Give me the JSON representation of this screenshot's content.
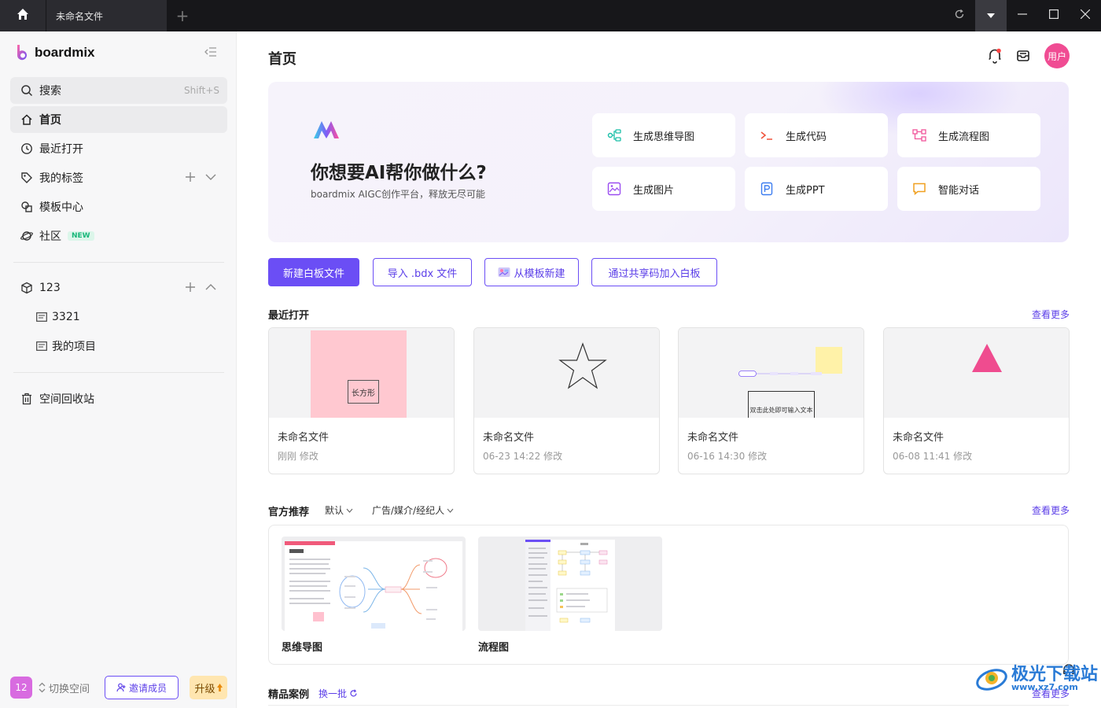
{
  "titlebar": {
    "tab_title": "未命名文件",
    "new_tab": "+"
  },
  "sidebar": {
    "brand": "boardmix",
    "search": {
      "label": "搜索",
      "shortcut": "Shift+S"
    },
    "items": [
      {
        "label": "首页"
      },
      {
        "label": "最近打开"
      },
      {
        "label": "我的标签"
      },
      {
        "label": "模板中心"
      },
      {
        "label": "社区",
        "badge": "NEW"
      }
    ],
    "team": {
      "label": "123",
      "children": [
        "3321",
        "我的项目"
      ]
    },
    "trash": "空间回收站",
    "bottom": {
      "space_count": "12",
      "switch_label": "切换空间",
      "invite_label": "邀请成员",
      "upgrade_label": "升级"
    }
  },
  "header": {
    "title": "首页",
    "avatar_label": "用户"
  },
  "ai": {
    "title": "你想要AI帮你做什么?",
    "subtitle": "boardmix AIGC创作平台，释放无尽可能",
    "cards": [
      "生成思维导图",
      "生成代码",
      "生成流程图",
      "生成图片",
      "生成PPT",
      "智能对话"
    ]
  },
  "actions": [
    "新建白板文件",
    "导入 .bdx 文件",
    "从模板新建",
    "通过共享码加入白板"
  ],
  "recent": {
    "title": "最近打开",
    "see_more": "查看更多",
    "files": [
      {
        "name": "未命名文件",
        "time": "刚刚 修改",
        "thumb_text": "长方形"
      },
      {
        "name": "未命名文件",
        "time": "06-23 14:22 修改"
      },
      {
        "name": "未命名文件",
        "time": "06-16 14:30 修改",
        "thumb_text": "双击此处即可输入文本"
      },
      {
        "name": "未命名文件",
        "time": "06-08 11:41 修改"
      }
    ]
  },
  "official": {
    "title": "官方推荐",
    "filter_sort": "默认",
    "filter_category": "广告/媒介/经纪人",
    "see_more": "查看更多",
    "templates": [
      "思维导图",
      "流程图"
    ]
  },
  "featured": {
    "title": "精品案例",
    "refresh": "换一批",
    "see_more": "查看更多"
  },
  "watermark": {
    "text": "极光下载站",
    "url": "www.xz7.com"
  },
  "colors": {
    "accent": "#6b4ef5",
    "titlebar": "#17171a",
    "avatar": "#f04c93"
  }
}
